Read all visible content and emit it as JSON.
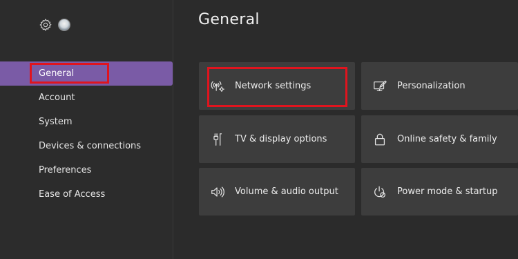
{
  "header": {
    "title": "General"
  },
  "sidebar": {
    "icons": {
      "settings": "gear-icon",
      "profile": "avatar"
    },
    "items": [
      {
        "label": "General",
        "selected": true
      },
      {
        "label": "Account",
        "selected": false
      },
      {
        "label": "System",
        "selected": false
      },
      {
        "label": "Devices & connections",
        "selected": false
      },
      {
        "label": "Preferences",
        "selected": false
      },
      {
        "label": "Ease of Access",
        "selected": false
      }
    ]
  },
  "tiles": [
    {
      "label": "Network settings",
      "icon": "network-settings-icon"
    },
    {
      "label": "Personalization",
      "icon": "personalization-icon"
    },
    {
      "label": "TV & display options",
      "icon": "tv-display-icon"
    },
    {
      "label": "Online safety & family",
      "icon": "lock-icon"
    },
    {
      "label": "Volume & audio output",
      "icon": "speaker-icon"
    },
    {
      "label": "Power mode & startup",
      "icon": "power-icon"
    }
  ],
  "colors": {
    "background": "#2b2b2b",
    "tile": "#3d3d3d",
    "selected": "#7a5ba6",
    "highlight": "#e0141e"
  }
}
